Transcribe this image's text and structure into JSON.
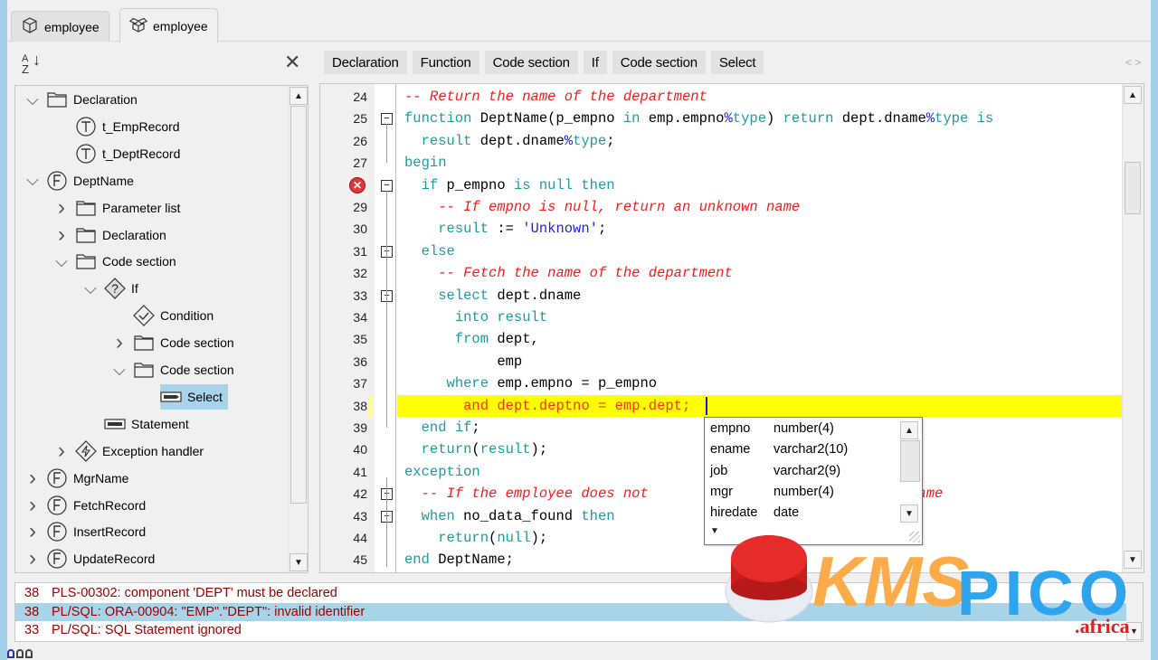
{
  "tabs": [
    {
      "label": "employee",
      "icon": "package-icon",
      "active": false
    },
    {
      "label": "employee",
      "icon": "package-open-icon",
      "active": true
    }
  ],
  "left_header": {
    "sort_icon": "sort-az-icon",
    "close_icon": "close-icon"
  },
  "tree": [
    {
      "label": "Declaration",
      "icon": "folder-open",
      "expand": "down",
      "level": 0
    },
    {
      "label": "t_EmpRecord",
      "icon": "type",
      "expand": "none",
      "level": 1
    },
    {
      "label": "t_DeptRecord",
      "icon": "type",
      "expand": "none",
      "level": 1
    },
    {
      "label": "DeptName",
      "icon": "function",
      "expand": "down",
      "level": 0
    },
    {
      "label": "Parameter list",
      "icon": "folder",
      "expand": "right",
      "level": 1
    },
    {
      "label": "Declaration",
      "icon": "folder",
      "expand": "right",
      "level": 1
    },
    {
      "label": "Code section",
      "icon": "folder-open",
      "expand": "down",
      "level": 1
    },
    {
      "label": "If",
      "icon": "if",
      "expand": "down",
      "level": 2
    },
    {
      "label": "Condition",
      "icon": "condition",
      "expand": "none",
      "level": 3
    },
    {
      "label": "Code section",
      "icon": "folder",
      "expand": "right",
      "level": 3
    },
    {
      "label": "Code section",
      "icon": "folder-open",
      "expand": "down",
      "level": 3
    },
    {
      "label": "Select",
      "icon": "select",
      "expand": "none",
      "level": 4,
      "selected": true
    },
    {
      "label": "Statement",
      "icon": "statement",
      "expand": "none",
      "level": 2
    },
    {
      "label": "Exception handler",
      "icon": "exception",
      "expand": "right",
      "level": 1
    },
    {
      "label": "MgrName",
      "icon": "function",
      "expand": "right",
      "level": 0
    },
    {
      "label": "FetchRecord",
      "icon": "function",
      "expand": "right",
      "level": 0
    },
    {
      "label": "InsertRecord",
      "icon": "function",
      "expand": "right",
      "level": 0
    },
    {
      "label": "UpdateRecord",
      "icon": "function",
      "expand": "right",
      "level": 0
    }
  ],
  "breadcrumbs": [
    "Declaration",
    "Function",
    "Code section",
    "If",
    "Code section",
    "Select"
  ],
  "nav_arrows": "< >",
  "code_lines": [
    {
      "n": "24",
      "fold": false,
      "segs": [
        [
          "cm",
          "-- Return the name of the department"
        ]
      ]
    },
    {
      "n": "25",
      "fold": true,
      "segs": [
        [
          "kw",
          "function "
        ],
        [
          "pl",
          "DeptName(p_empno "
        ],
        [
          "kw",
          "in "
        ],
        [
          "pl",
          "emp.empno"
        ],
        [
          "pct",
          "%"
        ],
        [
          "kw",
          "type"
        ],
        [
          "pl",
          ") "
        ],
        [
          "kw",
          "return "
        ],
        [
          "pl",
          "dept.dname"
        ],
        [
          "pct",
          "%"
        ],
        [
          "kw",
          "type is"
        ]
      ]
    },
    {
      "n": "26",
      "fold": false,
      "segs": [
        [
          "pl",
          "  "
        ],
        [
          "kw",
          "result "
        ],
        [
          "pl",
          "dept.dname"
        ],
        [
          "pct",
          "%"
        ],
        [
          "kw",
          "type"
        ],
        [
          "pl",
          ";"
        ]
      ]
    },
    {
      "n": "27",
      "fold": false,
      "segs": [
        [
          "kw",
          "begin"
        ]
      ]
    },
    {
      "n": "",
      "error": true,
      "fold": true,
      "segs": [
        [
          "pl",
          "  "
        ],
        [
          "kw",
          "if "
        ],
        [
          "pl",
          "p_empno "
        ],
        [
          "kw",
          "is null then"
        ]
      ]
    },
    {
      "n": "29",
      "fold": false,
      "segs": [
        [
          "pl",
          "    "
        ],
        [
          "cm",
          "-- If empno is null, return an unknown name"
        ]
      ]
    },
    {
      "n": "30",
      "fold": false,
      "segs": [
        [
          "pl",
          "    "
        ],
        [
          "kw",
          "result "
        ],
        [
          "pl",
          ":= "
        ],
        [
          "st",
          "'Unknown'"
        ],
        [
          "pl",
          ";"
        ]
      ]
    },
    {
      "n": "31",
      "fold": true,
      "segs": [
        [
          "pl",
          "  "
        ],
        [
          "kw",
          "else"
        ]
      ]
    },
    {
      "n": "32",
      "fold": false,
      "segs": [
        [
          "pl",
          "    "
        ],
        [
          "cm",
          "-- Fetch the name of the department"
        ]
      ]
    },
    {
      "n": "33",
      "fold": true,
      "segs": [
        [
          "pl",
          "    "
        ],
        [
          "kw",
          "select "
        ],
        [
          "pl",
          "dept.dname"
        ]
      ]
    },
    {
      "n": "34",
      "fold": false,
      "segs": [
        [
          "pl",
          "      "
        ],
        [
          "kw",
          "into result"
        ]
      ]
    },
    {
      "n": "35",
      "fold": false,
      "segs": [
        [
          "pl",
          "      "
        ],
        [
          "kw",
          "from "
        ],
        [
          "pl",
          "dept,"
        ]
      ]
    },
    {
      "n": "36",
      "fold": false,
      "segs": [
        [
          "pl",
          "           emp"
        ]
      ]
    },
    {
      "n": "37",
      "fold": false,
      "segs": [
        [
          "pl",
          "     "
        ],
        [
          "kw",
          "where "
        ],
        [
          "pl",
          "emp.empno = p_empno"
        ]
      ]
    },
    {
      "n": "38",
      "fold": false,
      "highlight": true,
      "segs": [
        [
          "pl",
          "       "
        ],
        [
          "kw",
          "and "
        ],
        [
          "pl",
          "dept.deptno = emp.dept;"
        ]
      ]
    },
    {
      "n": "39",
      "fold": false,
      "segs": [
        [
          "pl",
          "  "
        ],
        [
          "kw",
          "end if"
        ],
        [
          "pl",
          ";"
        ]
      ]
    },
    {
      "n": "40",
      "fold": false,
      "segs": [
        [
          "pl",
          "  "
        ],
        [
          "kw",
          "return"
        ],
        [
          "pl",
          "("
        ],
        [
          "kw",
          "result"
        ],
        [
          "pl",
          ");"
        ]
      ]
    },
    {
      "n": "41",
      "fold": false,
      "segs": [
        [
          "kw",
          "exception"
        ]
      ]
    },
    {
      "n": "42",
      "fold": true,
      "segs": [
        [
          "pl",
          "  "
        ],
        [
          "cm",
          "-- If the employee does not"
        ],
        [
          "pl",
          "                             "
        ],
        [
          "cm",
          "y name"
        ]
      ]
    },
    {
      "n": "43",
      "fold": true,
      "segs": [
        [
          "pl",
          "  "
        ],
        [
          "kw",
          "when "
        ],
        [
          "pl",
          "no_data_found "
        ],
        [
          "kw",
          "then"
        ]
      ]
    },
    {
      "n": "44",
      "fold": false,
      "segs": [
        [
          "pl",
          "    "
        ],
        [
          "kw",
          "return"
        ],
        [
          "pl",
          "("
        ],
        [
          "kw",
          "null"
        ],
        [
          "pl",
          ");"
        ]
      ]
    },
    {
      "n": "45",
      "fold": false,
      "segs": [
        [
          "kw",
          "end "
        ],
        [
          "pl",
          "DeptName;"
        ]
      ]
    }
  ],
  "autocomplete": [
    {
      "name": "empno",
      "type": "number(4)"
    },
    {
      "name": "ename",
      "type": "varchar2(10)"
    },
    {
      "name": "job",
      "type": "varchar2(9)"
    },
    {
      "name": "mgr",
      "type": "number(4)"
    },
    {
      "name": "hiredate",
      "type": "date"
    }
  ],
  "errors": [
    {
      "line": "38",
      "message": "PLS-00302: component 'DEPT' must be declared",
      "selected": false
    },
    {
      "line": "38",
      "message": "PL/SQL: ORA-00904: \"EMP\".\"DEPT\": invalid identifier",
      "selected": true
    },
    {
      "line": "33",
      "message": "PL/SQL: SQL Statement ignored",
      "selected": false
    }
  ],
  "watermark": {
    "part1": "KMS",
    "part2": "PICO",
    "suffix": ".africa"
  },
  "colors": {
    "accent": "#a8d4ea",
    "highlight": "#ffff00",
    "comment": "#ff1a1a",
    "keyword": "#1f9c9c",
    "error": "#a00000"
  }
}
